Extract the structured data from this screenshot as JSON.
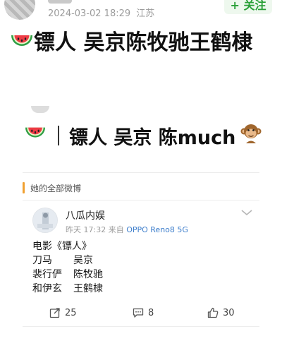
{
  "author": {
    "timestamp": "2024-03-02 18:29",
    "location": "江苏",
    "follow_label": "+ 关注"
  },
  "headline": {
    "text": "镖人 吴京陈牧驰王鹤棣",
    "emoji_icon": "watermelon-icon"
  },
  "sub_headline": {
    "emoji_icon": "watermelon-icon",
    "text": "镖人 吴京 陈much",
    "trailing_icon": "monkey-icon"
  },
  "weibo_card": {
    "section_label": "她的全部微博",
    "marker_color": "#f0a030",
    "source": {
      "name": "八瓜内娱",
      "time": "昨天 17:32",
      "from_label": "来自",
      "device": "OPPO Reno8 5G"
    },
    "post": {
      "title": "电影《镖人》",
      "cast": [
        {
          "role": "刀马",
          "actor": "吴京"
        },
        {
          "role": "裴行俨",
          "actor": "陈牧驰"
        },
        {
          "role": "和伊玄",
          "actor": "王鹤棣"
        }
      ]
    },
    "actions": {
      "repost_count": "25",
      "comment_count": "8",
      "like_count": "30"
    }
  },
  "colors": {
    "follow_green": "#2aa038",
    "device_blue": "#3f7fcc",
    "meta_gray": "#9b9b9b"
  }
}
